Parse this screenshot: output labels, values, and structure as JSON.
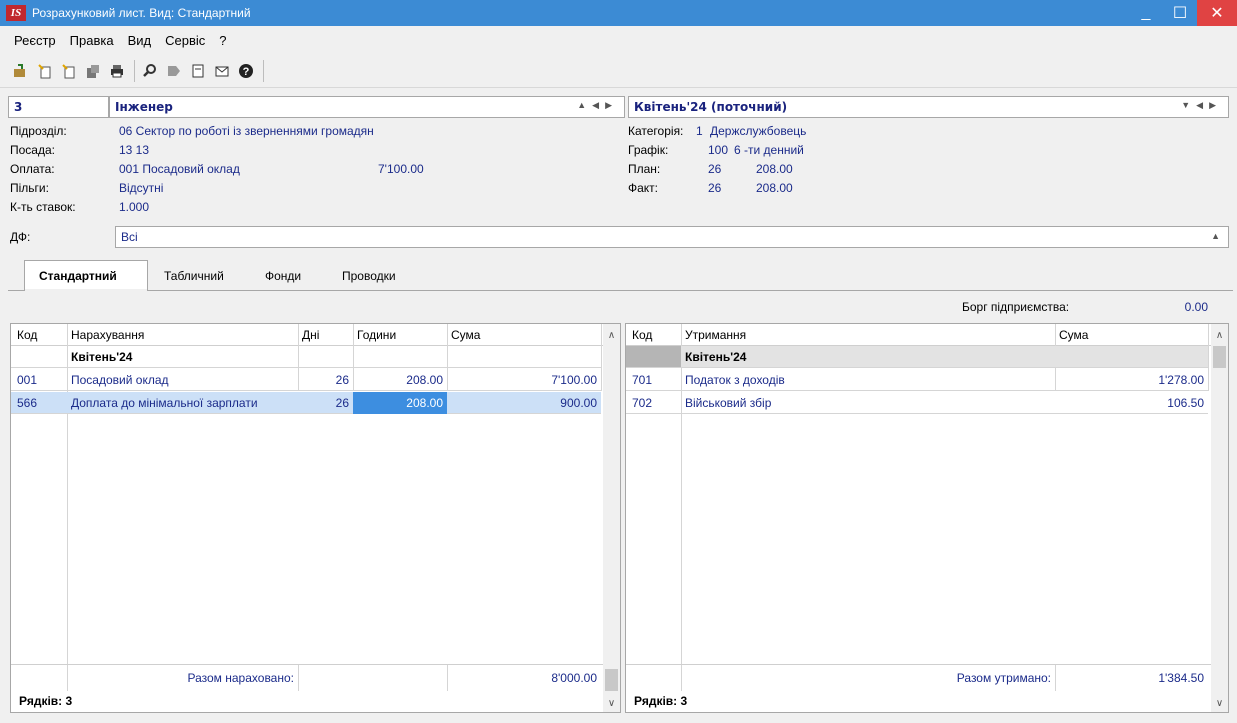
{
  "window": {
    "logo": "IS",
    "title": "Розрахунковий лист. Вид: Стандартний",
    "minimize": "_",
    "maximize": "☐",
    "close": "✕"
  },
  "menu": [
    "Реєстр",
    "Правка",
    "Вид",
    "Сервіс",
    "?"
  ],
  "toolbar_icons": [
    "open-icon",
    "new-icon",
    "new-copy-icon",
    "copy-icon",
    "print-icon",
    "search-icon",
    "export-icon",
    "document-icon",
    "mail-icon",
    "help-icon"
  ],
  "header": {
    "code": "3",
    "position_name": "Інженер",
    "period": "Квітень'24 (поточний)",
    "left_fields": [
      {
        "label": "Підрозділ:",
        "value": "06  Сектор по роботі із зверненнями громадян"
      },
      {
        "label": "Посада:",
        "value": "13  13"
      },
      {
        "label": "Оплата:",
        "value": "001 Посадовий оклад"
      },
      {
        "label": "Пільги:",
        "value": "Відсутні"
      },
      {
        "label": "К-ть ставок:",
        "value": "1.000"
      }
    ],
    "payment_amount": "7'100.00",
    "right_fields": [
      {
        "label": "Категорія:",
        "v1": "1",
        "v2": "Держслужбовець"
      },
      {
        "label": "Графік:",
        "v1": "100",
        "v2": "6 -ти денний"
      },
      {
        "label": "План:",
        "v1": "26",
        "v2": "208.00"
      },
      {
        "label": "Факт:",
        "v1": "26",
        "v2": "208.00"
      }
    ],
    "df_label": "ДФ:",
    "df_value": "Всі"
  },
  "tabs": [
    "Стандартний",
    "Табличний",
    "Фонди",
    "Проводки"
  ],
  "debt": {
    "label": "Борг підприємства:",
    "value": "0.00"
  },
  "accruals": {
    "columns": [
      "Код",
      "Нарахування",
      "Дні",
      "Години",
      "Сума"
    ],
    "group": "Квітень'24",
    "rows": [
      {
        "code": "001",
        "name": "Посадовий оклад",
        "days": "26",
        "hours": "208.00",
        "sum": "7'100.00"
      },
      {
        "code": "566",
        "name": "Доплата до мінімальної зарплати",
        "days": "26",
        "hours": "208.00",
        "sum": "900.00"
      }
    ],
    "total_label": "Разом нараховано:",
    "total_value": "8'000.00",
    "rows_count": "Рядків: 3"
  },
  "deductions": {
    "columns": [
      "Код",
      "Утримання",
      "Сума"
    ],
    "group": "Квітень'24",
    "rows": [
      {
        "code": "701",
        "name": "Податок з доходів",
        "sum": "1'278.00"
      },
      {
        "code": "702",
        "name": "Військовий збір",
        "sum": "106.50"
      }
    ],
    "total_label": "Разом утримано:",
    "total_value": "1'384.50",
    "rows_count": "Рядків: 3"
  }
}
